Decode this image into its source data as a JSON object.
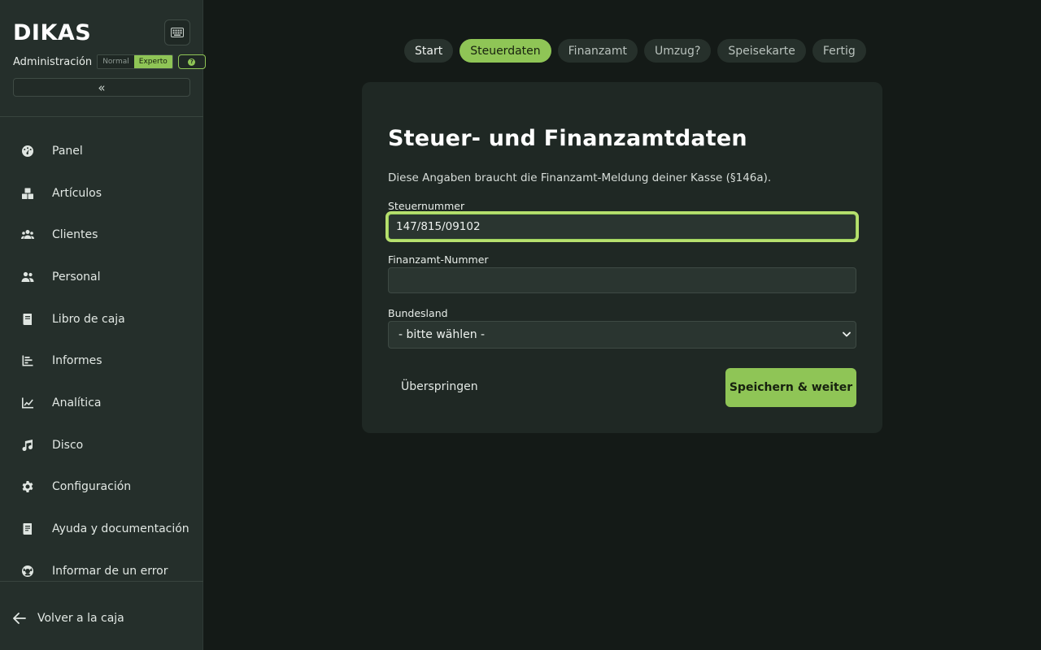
{
  "sidebar": {
    "logo": "DIKAS",
    "mode": {
      "label": "Administración",
      "options": [
        "Normal",
        "Experto"
      ],
      "selected": "Experto"
    },
    "help_badge": "?",
    "collapse_label": "«",
    "items": [
      {
        "label": "Panel",
        "icon": "dashboard-icon"
      },
      {
        "label": "Artículos",
        "icon": "boxes-icon"
      },
      {
        "label": "Clientes",
        "icon": "users-icon"
      },
      {
        "label": "Personal",
        "icon": "staff-icon"
      },
      {
        "label": "Libro de caja",
        "icon": "book-icon"
      },
      {
        "label": "Informes",
        "icon": "report-icon"
      },
      {
        "label": "Analítica",
        "icon": "chart-line-icon"
      },
      {
        "label": "Disco",
        "icon": "music-note-icon"
      },
      {
        "label": "Configuración",
        "icon": "gear-icon"
      },
      {
        "label": "Ayuda y documentación",
        "icon": "help-book-icon"
      },
      {
        "label": "Informar de un error",
        "icon": "lifebuoy-icon"
      }
    ],
    "back_label": "Volver a la caja"
  },
  "steps": [
    {
      "label": "Start",
      "state": "done"
    },
    {
      "label": "Steuerdaten",
      "state": "active"
    },
    {
      "label": "Finanzamt",
      "state": "pending"
    },
    {
      "label": "Umzug?",
      "state": "pending"
    },
    {
      "label": "Speisekarte",
      "state": "pending"
    },
    {
      "label": "Fertig",
      "state": "pending"
    }
  ],
  "form": {
    "title": "Steuer- und Finanzamtdaten",
    "description": "Diese Angaben braucht die Finanzamt-Meldung deiner Kasse (§146a).",
    "tax_number_label": "Steuernummer",
    "tax_number_value": "147/815/09102",
    "office_number_label": "Finanzamt-Nummer",
    "office_number_value": "",
    "state_label": "Bundesland",
    "state_value": "- bitte wählen -",
    "skip_label": "Überspringen",
    "save_label": "Speichern & weiter"
  },
  "colors": {
    "accent": "#8fc556",
    "background": "#141a17",
    "sidebar": "#252f2b",
    "card": "#1f2824"
  }
}
